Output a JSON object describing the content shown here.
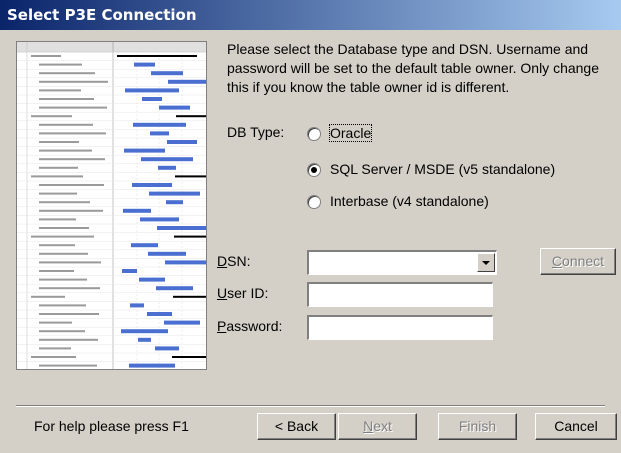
{
  "window": {
    "title": "Select P3E Connection"
  },
  "intro_text": "Please select the Database type and DSN. Username and password will be set to the default table owner. Only change this if you know the table owner id is different.",
  "db_type": {
    "label": "DB Type:",
    "options": [
      {
        "label": "Oracle",
        "selected": false
      },
      {
        "label": "SQL Server / MSDE (v5 standalone)",
        "selected": true
      },
      {
        "label": "Interbase (v4 standalone)",
        "selected": false
      }
    ]
  },
  "dsn": {
    "label_mnemonic": "D",
    "label_rest": "SN:",
    "value": ""
  },
  "connect_button": {
    "mnemonic": "C",
    "rest": "onnect"
  },
  "user_id": {
    "label_mnemonic": "U",
    "label_rest": "ser ID:",
    "value": ""
  },
  "password": {
    "label_mnemonic": "P",
    "label_rest": "assword:",
    "value": ""
  },
  "footer": {
    "help_text": "For help please press F1",
    "back_label": "< Back",
    "next_mnemonic": "N",
    "next_rest": "ext",
    "finish_label": "Finish",
    "cancel_label": "Cancel"
  },
  "colors": {
    "title_start": "#0a246a",
    "title_end": "#a6caf0",
    "face": "#d4d0c8",
    "gantt_bar": "#4a6fd0"
  }
}
